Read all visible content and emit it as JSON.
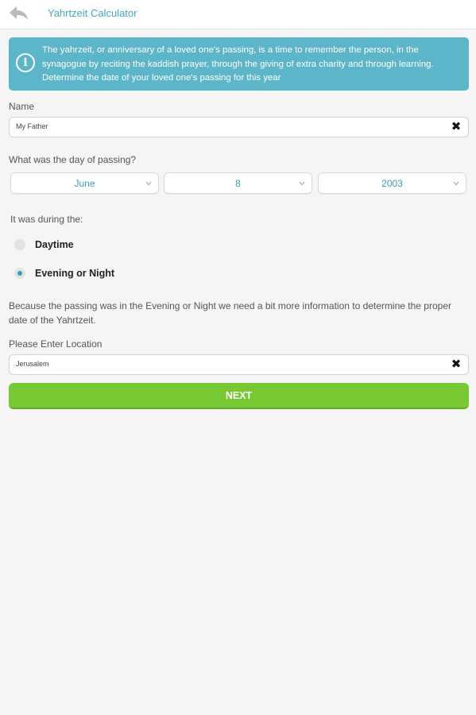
{
  "header": {
    "title": "Yahrtzeit Calculator",
    "back_icon": "reply-arrow-icon"
  },
  "info": {
    "icon": "info-icon",
    "icon_glyph": "i",
    "text": "The yahrzeit, or anniversary of a loved one's passing, is a time to remember the person, in the synagogue by reciting the kaddish prayer, through the giving of extra charity and through learning. Determine the date of your loved one's passing for this year"
  },
  "name_field": {
    "label": "Name",
    "value": "My Father",
    "clear_glyph": "✖"
  },
  "date": {
    "label": "What was the day of passing?",
    "month": "June",
    "day": "8",
    "year": "2003"
  },
  "time_of_day": {
    "label": "It was during the:",
    "options": [
      {
        "label": "Daytime",
        "checked": false
      },
      {
        "label": "Evening or Night",
        "checked": true
      }
    ]
  },
  "explanation": "Because the passing was in the Evening or Night we need a bit more information to determine the proper date of the Yahrtzeit.",
  "location_field": {
    "label": "Please Enter Location",
    "value": "Jerusalem",
    "clear_glyph": "✖"
  },
  "next_button": {
    "label": "NEXT"
  },
  "colors": {
    "accent": "#5cb5c8",
    "link": "#3c9bb3",
    "button": "#77c832",
    "background": "#f6f5f6"
  }
}
